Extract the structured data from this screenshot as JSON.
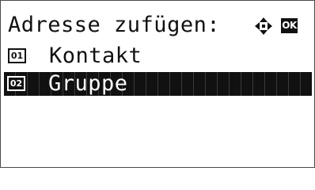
{
  "header": {
    "title": "Adresse zufügen:",
    "nav_icon": "four-way-arrow-icon",
    "ok_label": "OK"
  },
  "menu": {
    "items": [
      {
        "number": "01",
        "label": "Kontakt",
        "selected": false
      },
      {
        "number": "02",
        "label": "Gruppe",
        "selected": true
      }
    ]
  },
  "colors": {
    "foreground": "#111111",
    "background": "#ffffff",
    "highlight": "#111111"
  }
}
